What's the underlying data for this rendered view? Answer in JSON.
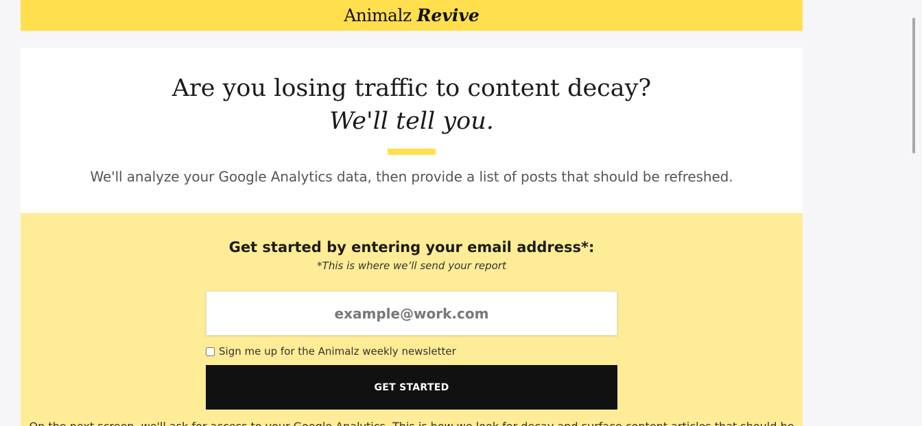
{
  "header": {
    "brand": "Animalz",
    "product": "Revive"
  },
  "hero": {
    "headline": "Are you losing traffic to content decay?",
    "headline_italic": "We'll tell you.",
    "description": "We'll analyze your Google Analytics data, then provide a list of posts that should be refreshed."
  },
  "signup": {
    "title": "Get started by entering your email address*:",
    "subtitle": "*This is where we’ll send your report",
    "email_placeholder": "example@work.com",
    "email_value": "",
    "newsletter_label": "Sign me up for the Animalz weekly newsletter",
    "newsletter_checked": false,
    "button_label": "GET STARTED",
    "footer_text_partial": "On the next screen, we'll ask for access to your Google Analytics. This is how we look for decay and surface content articles that should be"
  },
  "colors": {
    "brand_yellow": "#ffdf4e",
    "signup_bg": "#ffec96",
    "button_bg": "#111111"
  }
}
